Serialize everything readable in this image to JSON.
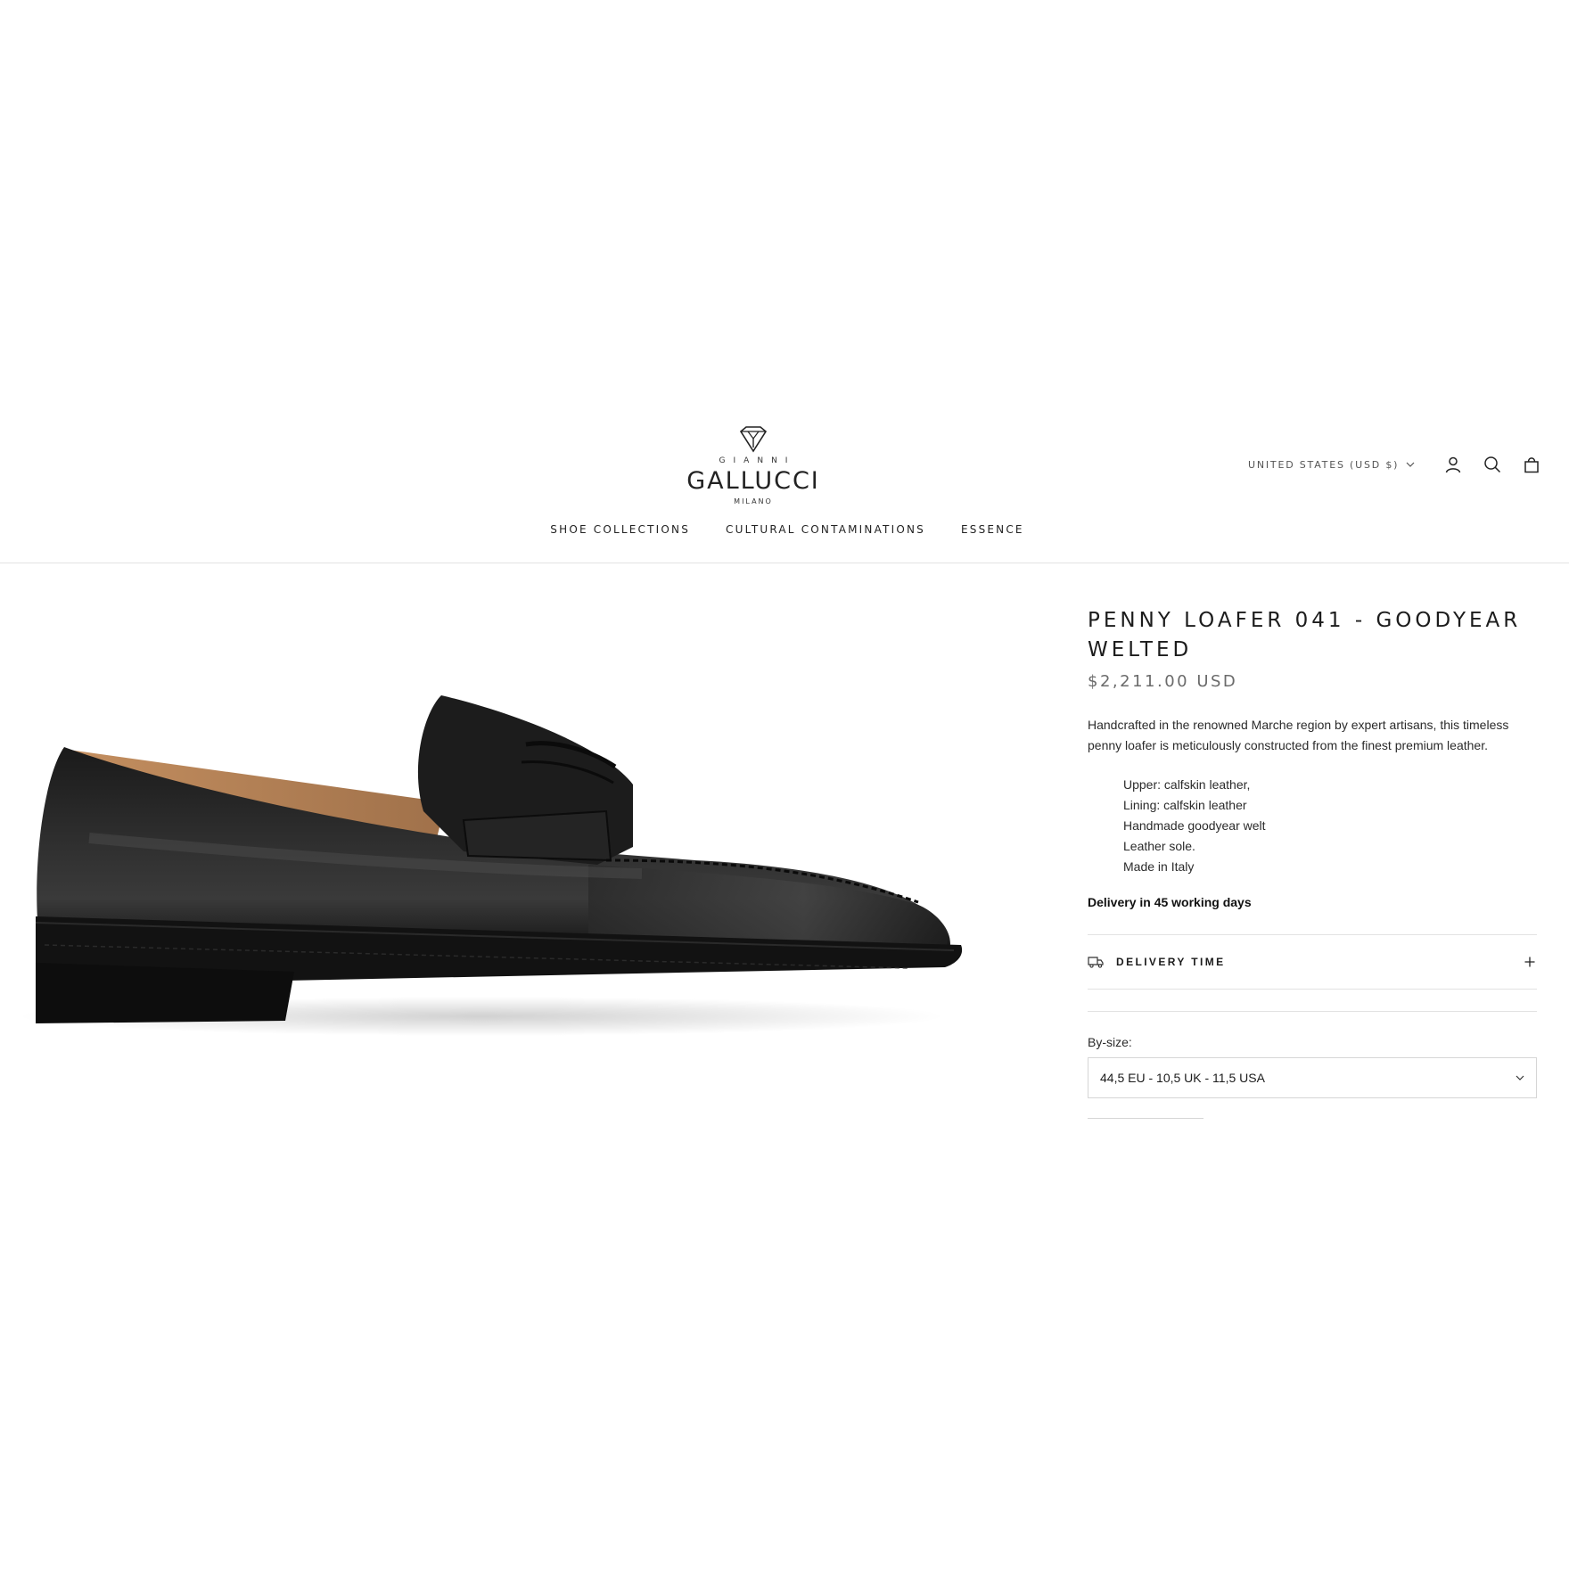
{
  "brand": {
    "top": "GIANNI",
    "name": "GALLUCCI",
    "sub": "MILANO"
  },
  "header": {
    "country_selector": "UNITED STATES (USD $)",
    "icons": [
      "account-icon",
      "search-icon",
      "cart-icon"
    ]
  },
  "nav": {
    "items": [
      {
        "label": "SHOE COLLECTIONS"
      },
      {
        "label": "CULTURAL CONTAMINATIONS"
      },
      {
        "label": "ESSENCE"
      }
    ]
  },
  "product": {
    "title": "PENNY LOAFER 041 - GOODYEAR WELTED",
    "price": "$2,211.00 USD",
    "description": "Handcrafted in the renowned Marche region by expert artisans, this timeless penny loafer is meticulously constructed from the finest premium leather.",
    "features": [
      "Upper: calfskin leather,",
      "Lining: calfskin leather",
      "Handmade goodyear welt",
      "Leather sole.",
      "Made in Italy"
    ],
    "delivery_note": "Delivery in 45 working days",
    "accordion_label": "DELIVERY TIME",
    "size_label": "By-size:",
    "size_value": "44,5 EU - 10,5 UK - 11,5 USA"
  },
  "colors": {
    "border": "#e2e2e2",
    "text": "#1c1c1c",
    "price": "#6b6b6b",
    "shoe": "#141414",
    "lining": "#b27d52"
  }
}
